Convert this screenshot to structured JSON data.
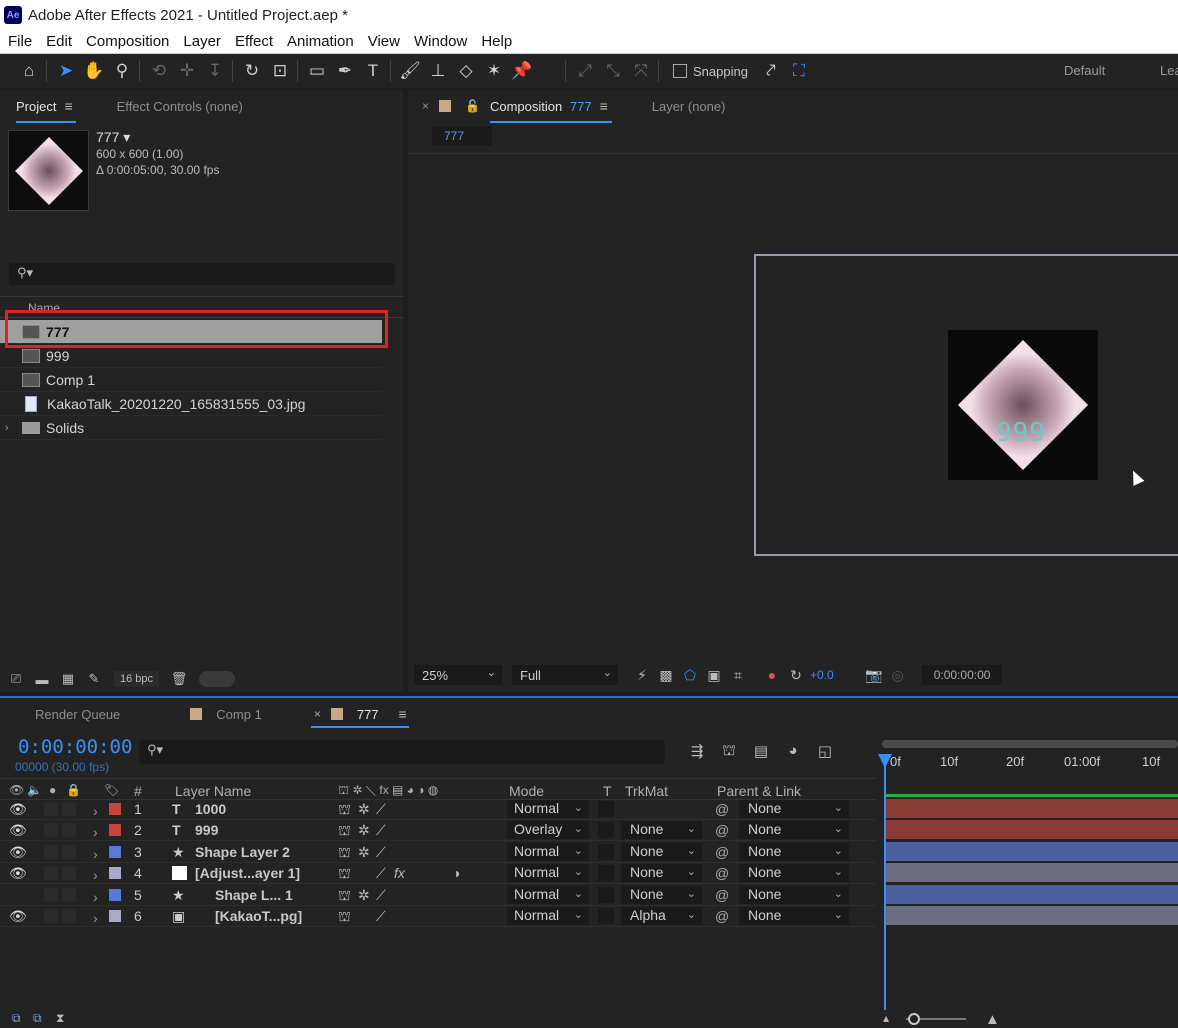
{
  "window": {
    "app_badge": "Ae",
    "title": "Adobe After Effects 2021 - Untitled Project.aep *"
  },
  "menu": [
    "File",
    "Edit",
    "Composition",
    "Layer",
    "Effect",
    "Animation",
    "View",
    "Window",
    "Help"
  ],
  "toolbar": {
    "snapping_label": "Snapping",
    "workspace_default": "Default",
    "workspace_learn": "Lea"
  },
  "project_panel": {
    "tab_project": "Project",
    "tab_effect_controls": "Effect Controls (none)",
    "selected_item": {
      "name": "777 ▾",
      "dimensions": "600 x 600 (1.00)",
      "duration": "Δ 0:00:05:00, 30.00 fps"
    },
    "column_name": "Name",
    "items": [
      {
        "label": "777",
        "type": "composition",
        "selected": true
      },
      {
        "label": "999",
        "type": "composition"
      },
      {
        "label": "Comp 1",
        "type": "composition"
      },
      {
        "label": "KakaoTalk_20201220_165831555_03.jpg",
        "type": "image"
      },
      {
        "label": "Solids",
        "type": "folder"
      }
    ],
    "footer_bpc": "16 bpc"
  },
  "composition_panel": {
    "tab_label": "Composition",
    "tab_comp_name": "777",
    "tab_layer": "Layer (none)",
    "breadcrumb": "777",
    "preview_digits": "999",
    "zoom": "25%",
    "resolution": "Full",
    "exposure": "+0.0",
    "timecode": "0:00:00:00"
  },
  "timeline": {
    "tab_render_queue": "Render Queue",
    "tab_comp1": "Comp 1",
    "tab_active": "777",
    "current_time": "0:00:00:00",
    "fps": "00000 (30.00 fps)",
    "headers": {
      "num": "#",
      "layer_name": "Layer Name",
      "mode": "Mode",
      "t": "T",
      "trkmat": "TrkMat",
      "parent": "Parent & Link"
    },
    "ruler_labels": [
      "0f",
      "10f",
      "20f",
      "01:00f",
      "10f"
    ],
    "layers": [
      {
        "num": "1",
        "type_glyph": "T",
        "name": "1000",
        "mode": "Normal",
        "trkmat": "",
        "parent": "None",
        "color": "#c8453b",
        "bar_color": "#8a3b35",
        "visible": true
      },
      {
        "num": "2",
        "type_glyph": "T",
        "name": "999",
        "mode": "Overlay",
        "trkmat": "None",
        "parent": "None",
        "color": "#c8453b",
        "bar_color": "#8a3b35",
        "visible": true
      },
      {
        "num": "3",
        "type_glyph": "★",
        "name": "Shape Layer 2",
        "mode": "Normal",
        "trkmat": "None",
        "parent": "None",
        "color": "#5a78d8",
        "bar_color": "#4a5f9e",
        "visible": true
      },
      {
        "num": "4",
        "type_glyph": "□",
        "name": "[Adjust...ayer 1]",
        "mode": "Normal",
        "trkmat": "None",
        "parent": "None",
        "color": "#a9a9c8",
        "bar_color": "#6c6c80",
        "visible": true
      },
      {
        "num": "5",
        "type_glyph": "★",
        "name": "Shape L... 1",
        "mode": "Normal",
        "trkmat": "None",
        "parent": "None",
        "color": "#5a78d8",
        "bar_color": "#4a5f9e",
        "visible": false
      },
      {
        "num": "6",
        "type_glyph": "▣",
        "name": "[KakaoT...pg]",
        "mode": "Normal",
        "trkmat": "Alpha",
        "parent": "None",
        "color": "#a9a9c8",
        "bar_color": "#6c6c80",
        "visible": true
      }
    ]
  }
}
